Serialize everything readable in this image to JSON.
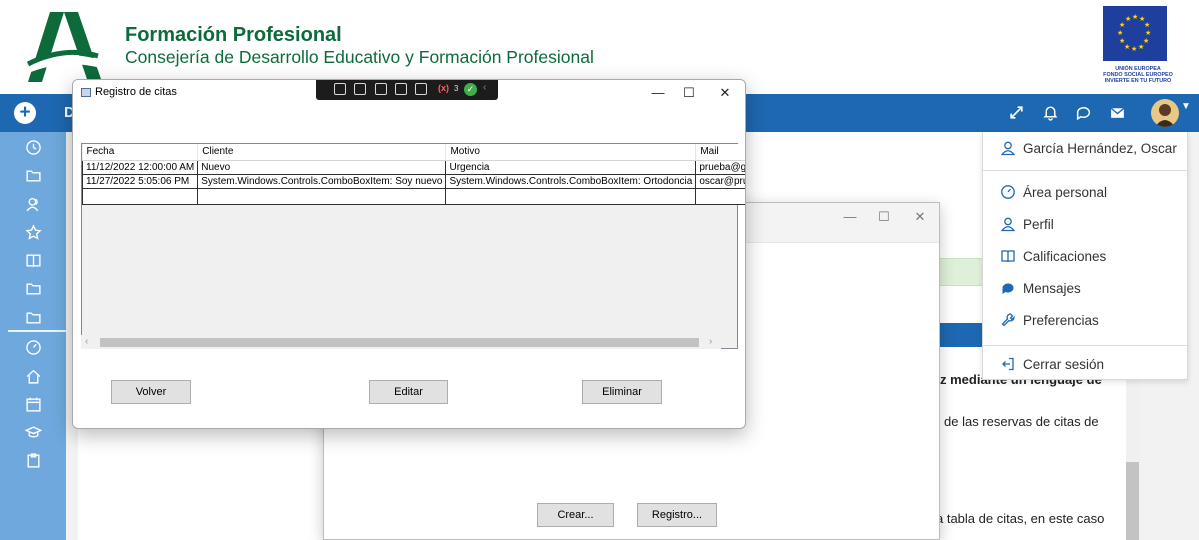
{
  "header": {
    "title": "Formación Profesional",
    "subtitle": "Consejería de Desarrollo Educativo y Formación Profesional",
    "eu_logo": {
      "line1": "UNIÓN EUROPEA",
      "line2": "FONDO SOCIAL EUROPEO",
      "line3": "INVIERTE EN TU FUTURO"
    }
  },
  "navbar": {
    "brand_letter": "D",
    "icons": [
      "expand-icon",
      "bell-icon",
      "chat-icon",
      "mail-icon"
    ]
  },
  "sidebar": {
    "icons": [
      "clock-icon",
      "folder-icon",
      "users-icon",
      "star-icon",
      "book-icon",
      "folder-icon",
      "folder-icon",
      "gauge-icon",
      "home-icon",
      "calendar-icon",
      "graduation-cap-icon",
      "clipboard-icon"
    ]
  },
  "background_page": {
    "text_1": "z mediante un lenguaje de",
    "text_2": "de las reservas de citas de",
    "text_3": "a tabla de citas, en este caso"
  },
  "user_menu": {
    "user_name": "García Hernández, Oscar",
    "items": [
      {
        "label": "Área personal",
        "icon": "gauge-icon"
      },
      {
        "label": "Perfil",
        "icon": "user-icon"
      },
      {
        "label": "Calificaciones",
        "icon": "gradebook-icon"
      },
      {
        "label": "Mensajes",
        "icon": "chat-bubble-icon"
      },
      {
        "label": "Preferencias",
        "icon": "wrench-icon"
      }
    ],
    "logout_label": "Cerrar sesión"
  },
  "second_window": {
    "crear_label": "Crear...",
    "registro_label": "Registro..."
  },
  "main_window": {
    "title": "Registro de citas",
    "tools_count": "3",
    "grid": {
      "columns": [
        "Fecha",
        "Cliente",
        "Motivo",
        "Mail"
      ],
      "rows": [
        [
          "11/12/2022 12:00:00 AM",
          "Nuevo",
          "Urgencia",
          "prueba@gmail.com"
        ],
        [
          "11/27/2022 5:05:06 PM",
          "System.Windows.Controls.ComboBoxItem: Soy nuevo",
          "System.Windows.Controls.ComboBoxItem: Ortodoncia",
          "oscar@prueba.com"
        ]
      ]
    },
    "buttons": {
      "volver": "Volver",
      "editar": "Editar",
      "eliminar": "Eliminar"
    }
  },
  "colors": {
    "brand_green": "#0d6b3b",
    "navbar_blue": "#1e68b1",
    "sidebar_blue": "#6ea8dc"
  }
}
